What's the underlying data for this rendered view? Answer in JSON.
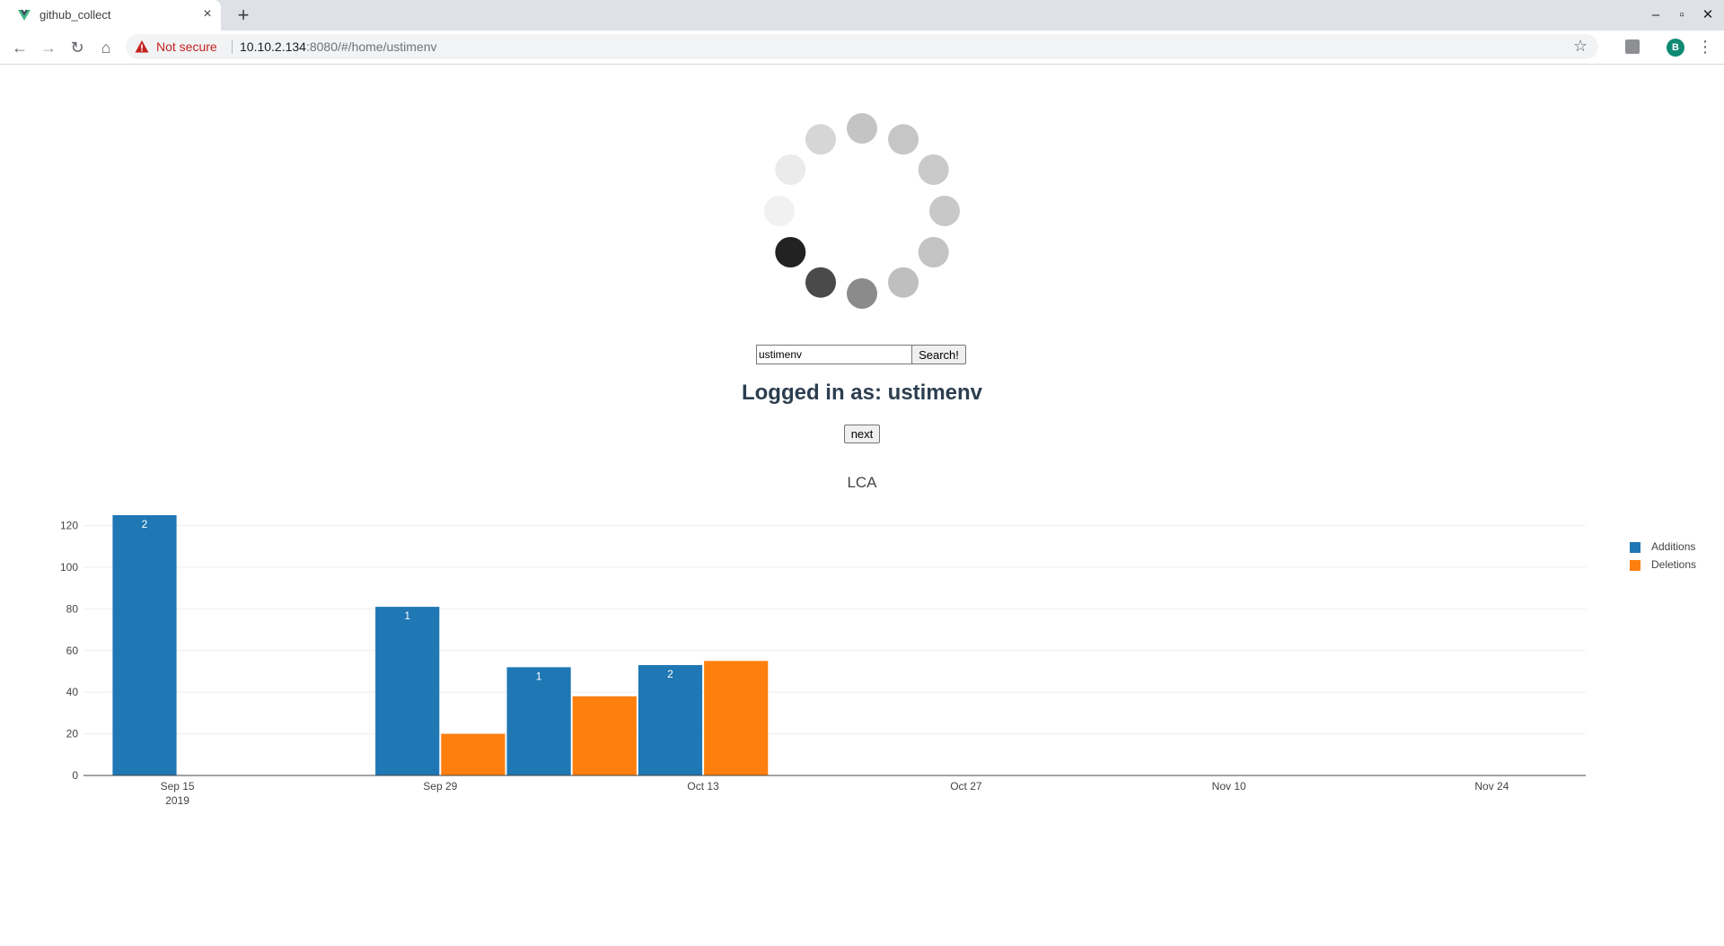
{
  "browser": {
    "tab": {
      "title": "github_collect",
      "close": "×"
    },
    "new_tab": "+",
    "window_controls": {
      "minimize": "–",
      "maximize": "▫",
      "close": "✕"
    },
    "toolbar": {
      "back": "←",
      "forward": "→",
      "reload": "↻",
      "home": "⌂",
      "security_label": "Not secure",
      "url_host": "10.10.2.134",
      "url_rest": ":8080/#/home/ustimenv",
      "bookmark": "☆",
      "profile_initial": "B",
      "menu": "⋮"
    }
  },
  "page": {
    "search": {
      "value": "ustimenv",
      "button_label": "Search!"
    },
    "logged_in_text": "Logged in as: ustimenv",
    "next_label": "next"
  },
  "colors": {
    "additions": "#1f77b4",
    "deletions": "#ff7f0e",
    "heading": "#2c3e50",
    "not_secure": "#c5221f"
  },
  "icons": {
    "tab_favicon": "vue-logo-icon",
    "security": "warning-triangle-icon",
    "extension": "extension-icon"
  },
  "spinner": {
    "dot_count": 12,
    "shades": [
      "#c4c4c4",
      "#c6c6c6",
      "#c9c9c9",
      "#c8c8c8",
      "#c3c3c3",
      "#bfbfbf",
      "#8b8b8b",
      "#4a4a4a",
      "#222222",
      "#f1f1f1",
      "#ebebeb",
      "#d6d6d6"
    ]
  },
  "chart_data": {
    "type": "bar",
    "title": "LCA",
    "x_type": "date",
    "x_range": [
      "2019-09-10",
      "2019-11-29"
    ],
    "x_ticks": [
      {
        "date": "2019-09-15",
        "label": "Sep 15",
        "sublabel": "2019"
      },
      {
        "date": "2019-09-29",
        "label": "Sep 29",
        "sublabel": ""
      },
      {
        "date": "2019-10-13",
        "label": "Oct 13",
        "sublabel": ""
      },
      {
        "date": "2019-10-27",
        "label": "Oct 27",
        "sublabel": ""
      },
      {
        "date": "2019-11-10",
        "label": "Nov 10",
        "sublabel": ""
      },
      {
        "date": "2019-11-24",
        "label": "Nov 24",
        "sublabel": ""
      }
    ],
    "ylim": [
      0,
      125
    ],
    "y_ticks": [
      0,
      20,
      40,
      60,
      80,
      100,
      120
    ],
    "grid": true,
    "legend_position": "top-right",
    "bar_width_days": 7,
    "series": [
      {
        "name": "Additions",
        "points": [
          {
            "x": "2019-09-15",
            "y": 125,
            "label": "2"
          },
          {
            "x": "2019-09-29",
            "y": 81,
            "label": "1"
          },
          {
            "x": "2019-10-06",
            "y": 52,
            "label": "1"
          },
          {
            "x": "2019-10-13",
            "y": 53,
            "label": "2"
          }
        ]
      },
      {
        "name": "Deletions",
        "points": [
          {
            "x": "2019-09-29",
            "y": 20
          },
          {
            "x": "2019-10-06",
            "y": 38
          },
          {
            "x": "2019-10-13",
            "y": 55
          }
        ]
      }
    ]
  }
}
